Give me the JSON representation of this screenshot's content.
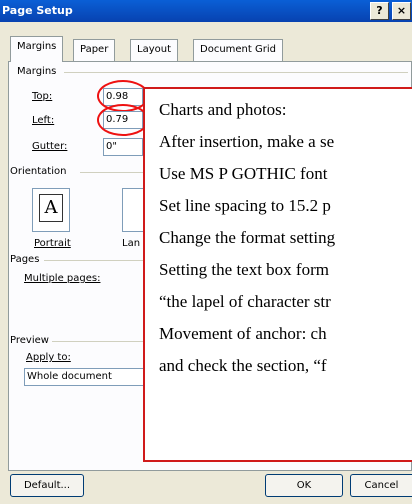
{
  "window": {
    "title": "Page Setup",
    "help": "?",
    "close": "×"
  },
  "tabs": [
    "Margins",
    "Paper",
    "Layout",
    "Document Grid"
  ],
  "margins": {
    "group_label": "Margins",
    "top_label": "Top:",
    "top_value": "0.98",
    "left_label": "Left:",
    "left_value": "0.79",
    "gutter_label": "Gutter:",
    "gutter_value": "0\""
  },
  "orientation": {
    "group_label": "Orientation",
    "glyph": "A",
    "portrait_label": "Portrait",
    "landscape_label": "Lan"
  },
  "pages": {
    "group_label": "Pages",
    "multiple_label": "Multiple pages:"
  },
  "preview": {
    "group_label": "Preview",
    "apply_label": "Apply to:",
    "apply_value": "Whole document"
  },
  "overlay_text": [
    "Charts and photos:",
    "After insertion, make a se",
    "Use MS P GOTHIC font",
    "Set line spacing to 15.2 p",
    "Change the format setting",
    "Setting the text box form",
    "“the lapel of character str",
    "Movement of anchor: ch",
    "and check the section, “f"
  ],
  "buttons": {
    "default": "Default...",
    "ok": "OK",
    "cancel": "Cancel"
  },
  "colors": {
    "annotation_red": "#e11111",
    "title_blue": "#0a5fd6"
  }
}
